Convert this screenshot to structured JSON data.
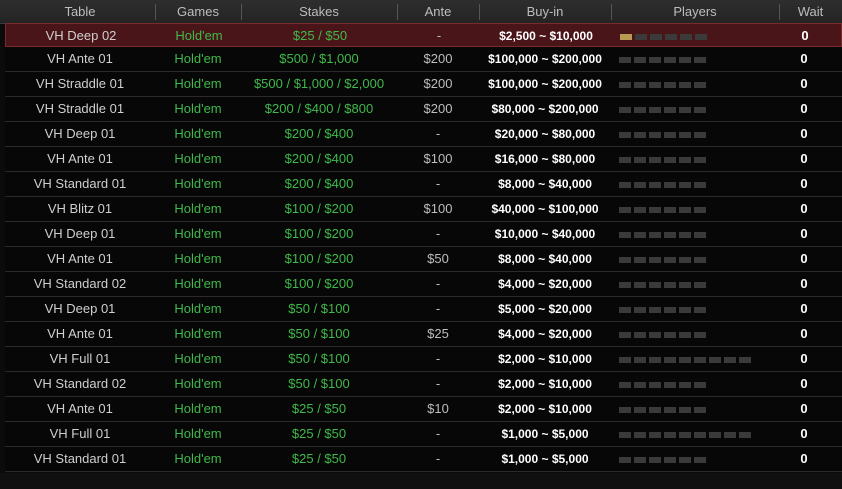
{
  "headers": {
    "table": "Table",
    "games": "Games",
    "stakes": "Stakes",
    "ante": "Ante",
    "buyin": "Buy-in",
    "players": "Players",
    "wait": "Wait"
  },
  "colors": {
    "selected_row": "#4a1519",
    "game_text": "#3fb94a",
    "seat_filled": "#b89a55",
    "seat_empty": "#3a3a3a"
  },
  "rows": [
    {
      "table": "VH Deep 02",
      "game": "Hold'em",
      "stakes": "$25 / $50",
      "ante": "-",
      "buyin": "$2,500 ~ $10,000",
      "seats": 6,
      "filled": 1,
      "wait": "0",
      "selected": true
    },
    {
      "table": "VH Ante 01",
      "game": "Hold'em",
      "stakes": "$500 / $1,000",
      "ante": "$200",
      "buyin": "$100,000 ~ $200,000",
      "seats": 6,
      "filled": 0,
      "wait": "0"
    },
    {
      "table": "VH Straddle 01",
      "game": "Hold'em",
      "stakes": "$500 / $1,000 / $2,000",
      "ante": "$200",
      "buyin": "$100,000 ~ $200,000",
      "seats": 6,
      "filled": 0,
      "wait": "0"
    },
    {
      "table": "VH Straddle 01",
      "game": "Hold'em",
      "stakes": "$200 / $400 / $800",
      "ante": "$200",
      "buyin": "$80,000 ~ $200,000",
      "seats": 6,
      "filled": 0,
      "wait": "0"
    },
    {
      "table": "VH Deep 01",
      "game": "Hold'em",
      "stakes": "$200 / $400",
      "ante": "-",
      "buyin": "$20,000 ~ $80,000",
      "seats": 6,
      "filled": 0,
      "wait": "0"
    },
    {
      "table": "VH Ante 01",
      "game": "Hold'em",
      "stakes": "$200 / $400",
      "ante": "$100",
      "buyin": "$16,000 ~ $80,000",
      "seats": 6,
      "filled": 0,
      "wait": "0"
    },
    {
      "table": "VH Standard 01",
      "game": "Hold'em",
      "stakes": "$200 / $400",
      "ante": "-",
      "buyin": "$8,000 ~ $40,000",
      "seats": 6,
      "filled": 0,
      "wait": "0"
    },
    {
      "table": "VH Blitz 01",
      "game": "Hold'em",
      "stakes": "$100 / $200",
      "ante": "$100",
      "buyin": "$40,000 ~ $100,000",
      "seats": 6,
      "filled": 0,
      "wait": "0"
    },
    {
      "table": "VH Deep 01",
      "game": "Hold'em",
      "stakes": "$100 / $200",
      "ante": "-",
      "buyin": "$10,000 ~ $40,000",
      "seats": 6,
      "filled": 0,
      "wait": "0"
    },
    {
      "table": "VH Ante 01",
      "game": "Hold'em",
      "stakes": "$100 / $200",
      "ante": "$50",
      "buyin": "$8,000 ~ $40,000",
      "seats": 6,
      "filled": 0,
      "wait": "0"
    },
    {
      "table": "VH Standard 02",
      "game": "Hold'em",
      "stakes": "$100 / $200",
      "ante": "-",
      "buyin": "$4,000 ~ $20,000",
      "seats": 6,
      "filled": 0,
      "wait": "0"
    },
    {
      "table": "VH Deep 01",
      "game": "Hold'em",
      "stakes": "$50 / $100",
      "ante": "-",
      "buyin": "$5,000 ~ $20,000",
      "seats": 6,
      "filled": 0,
      "wait": "0"
    },
    {
      "table": "VH Ante 01",
      "game": "Hold'em",
      "stakes": "$50 / $100",
      "ante": "$25",
      "buyin": "$4,000 ~ $20,000",
      "seats": 6,
      "filled": 0,
      "wait": "0"
    },
    {
      "table": "VH Full 01",
      "game": "Hold'em",
      "stakes": "$50 / $100",
      "ante": "-",
      "buyin": "$2,000 ~ $10,000",
      "seats": 9,
      "filled": 0,
      "wait": "0"
    },
    {
      "table": "VH Standard 02",
      "game": "Hold'em",
      "stakes": "$50 / $100",
      "ante": "-",
      "buyin": "$2,000 ~ $10,000",
      "seats": 6,
      "filled": 0,
      "wait": "0"
    },
    {
      "table": "VH Ante 01",
      "game": "Hold'em",
      "stakes": "$25 / $50",
      "ante": "$10",
      "buyin": "$2,000 ~ $10,000",
      "seats": 6,
      "filled": 0,
      "wait": "0"
    },
    {
      "table": "VH Full 01",
      "game": "Hold'em",
      "stakes": "$25 / $50",
      "ante": "-",
      "buyin": "$1,000 ~ $5,000",
      "seats": 9,
      "filled": 0,
      "wait": "0"
    },
    {
      "table": "VH Standard 01",
      "game": "Hold'em",
      "stakes": "$25 / $50",
      "ante": "-",
      "buyin": "$1,000 ~ $5,000",
      "seats": 6,
      "filled": 0,
      "wait": "0"
    }
  ]
}
